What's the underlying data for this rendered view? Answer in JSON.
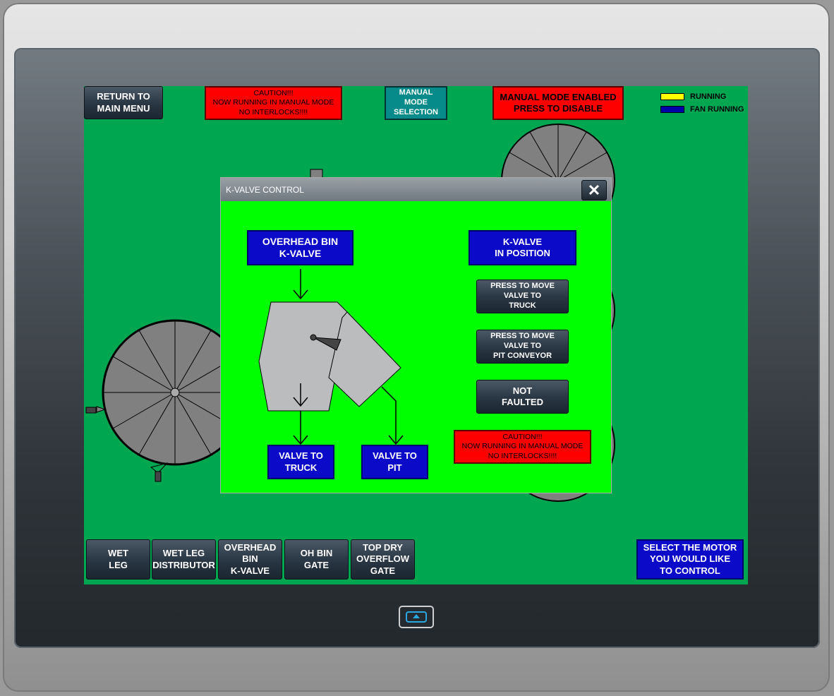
{
  "top": {
    "return_label": "RETURN TO\nMAIN MENU",
    "caution_label": "CAUTION!!!\nNOW RUNNING IN MANUAL MODE\nNO INTERLOCKS!!!!",
    "manual_mode_selection": "MANUAL\nMODE\nSELECTION",
    "manual_enabled_label": "MANUAL MODE ENABLED\nPRESS TO DISABLE"
  },
  "legend": {
    "running": "RUNNING",
    "running_color": "#ffff00",
    "fan_running": "FAN RUNNING",
    "fan_running_color": "#0000aa"
  },
  "dialog": {
    "title": "K-VALVE CONTROL",
    "close_icon": "close-icon",
    "source_label": "OVERHEAD BIN\nK-VALVE",
    "status_label": "K-VALVE\nIN POSITION",
    "move_truck_label": "PRESS TO MOVE\nVALVE TO\nTRUCK",
    "move_pit_label": "PRESS TO MOVE\nVALVE TO\nPIT CONVEYOR",
    "fault_label": "NOT\nFAULTED",
    "caution_label": "CAUTION!!!\nNOW RUNNING IN MANUAL MODE\nNO INTERLOCKS!!!!",
    "truck_label": "VALVE TO\nTRUCK",
    "pit_label": "VALVE TO\nPIT"
  },
  "bottom": {
    "buttons": [
      "WET\nLEG",
      "WET LEG\nDISTRIBUTOR",
      "OVERHEAD\nBIN\nK-VALVE",
      "OH BIN\nGATE",
      "TOP DRY\nOVERFLOW\nGATE"
    ],
    "select_motor_label": "SELECT THE MOTOR\nYOU WOULD LIKE\nTO CONTROL"
  },
  "colors": {
    "screen_bg": "#00a650",
    "dialog_bg": "#00ff00",
    "accent_blue": "#0a0ac8",
    "alarm_red": "#ff0000"
  }
}
